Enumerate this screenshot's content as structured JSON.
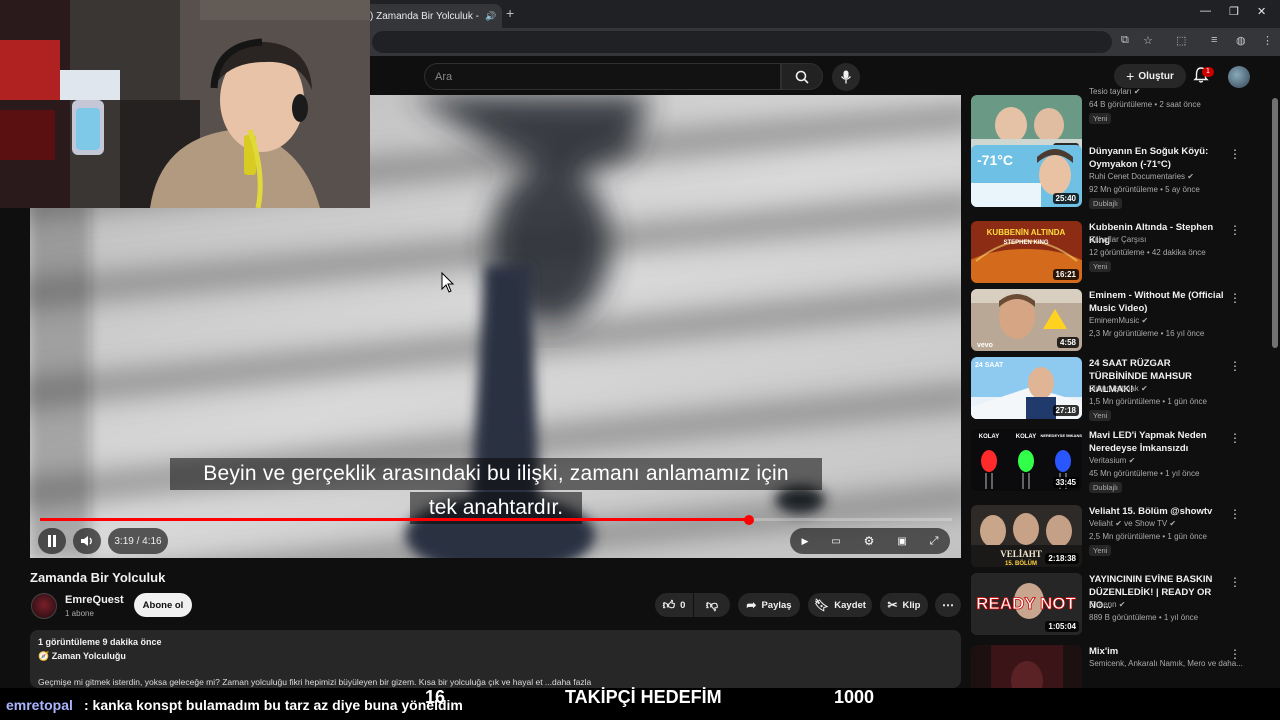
{
  "browser": {
    "tab_title": ") Zamanda Bir Yolculuk - ",
    "tab_close": "✕",
    "new_tab": "+"
  },
  "header": {
    "search_placeholder": "Ara",
    "create_label": "Oluştur",
    "notification_count": "1"
  },
  "video": {
    "subtitle_line1": "Beyin ve gerçeklik arasındaki bu ilişki, zamanı anlamamız için",
    "subtitle_line2": "tek anahtardır.",
    "time": "3:19 / 4:16",
    "progress": 0.777
  },
  "details": {
    "title": "Zamanda Bir Yolculuk",
    "channel": "EmreQuest",
    "subscribers": "1 abone",
    "subscribe_label": "Abone ol",
    "like_count": "0",
    "share_label": "Paylaş",
    "save_label": "Kaydet",
    "clip_label": "Klip",
    "views_time": "1 görüntüleme  9 dakika önce",
    "tag": "🧭 Zaman Yolculuğu",
    "description": "Geçmişe mi gitmek isterdin, yoksa geleceğe mi? Zaman yolculuğu fikri hepimizi büyüleyen bir gizem. Kısa bir yolculuğa çık ve hayal et ...daha fazla"
  },
  "sidebar": {
    "items": [
      {
        "title": "",
        "channel": "Tesio tayları ✔",
        "meta": "64 B görüntüleme • 2 saat önce",
        "badge": "Yeni",
        "duration": "28:04"
      },
      {
        "title": "Dünyanın En Soğuk Köyü: Oymyakon (-71°C)",
        "channel": "Ruhi Cenet Documentaries ✔",
        "meta": "92 Mn görüntüleme • 5 ay önce",
        "badge": "Dublajlı",
        "duration": "25:40"
      },
      {
        "title": "Kubbenin Altında - Stephen King",
        "channel": "Sahaflar Çarşısı",
        "meta": "12 görüntüleme • 42 dakika önce",
        "badge": "Yeni",
        "duration": "16:21"
      },
      {
        "title": "Eminem - Without Me (Official Music Video)",
        "channel": "EminemMusic ✔",
        "meta": "2,3 Mr görüntüleme • 16 yıl önce",
        "badge": "",
        "duration": "4:58"
      },
      {
        "title": "24 SAAT RÜZGAR TÜRBİNİNDE MAHSUR KALMAK!",
        "channel": "Orkun Işıtmak ✔",
        "meta": "1,5 Mn görüntüleme • 1 gün önce",
        "badge": "Yeni",
        "duration": "27:18"
      },
      {
        "title": "Mavi LED'i Yapmak Neden Neredeyse İmkansızdı",
        "channel": "Veritasium ✔",
        "meta": "45 Mn görüntüleme • 1 yıl önce",
        "badge": "Dublajlı",
        "duration": "33:45"
      },
      {
        "title": "Veliaht 15. Bölüm @showtv",
        "channel": "Veliaht ✔ ve Show TV ✔",
        "meta": "2,5 Mn görüntüleme • 1 gün önce",
        "badge": "Yeni",
        "duration": "2:18:38"
      },
      {
        "title": "YAYINCININ EVİNE BASKIN DÜZENLEDİK! | READY OR NO...",
        "channel": "Elraenn ✔",
        "meta": "889 B görüntüleme • 1 yıl önce",
        "badge": "",
        "duration": "1:05:04"
      },
      {
        "title": "Mix'im",
        "channel": "Semicenk, Ankaralı Namık, Mero ve daha...",
        "meta": "",
        "badge": "",
        "duration": ""
      }
    ],
    "thumb_texts": {
      "t1": "-71°C",
      "t2": "KUBBENİN ALTINDA",
      "t2b": "STEPHEN KING",
      "t3": "vevo",
      "t4": "24 SAAT",
      "t5a": "KOLAY",
      "t5b": "KOLAY",
      "t5c": "NEREDEYSE İMKANSIZ",
      "t6": "VELİAHT",
      "t6b": "15. BÖLÜM",
      "t7": "READY NOT"
    }
  },
  "overlay": {
    "chat_user": "emretopal",
    "chat_message": ": kanka konspt bulamadım bu tarz az diye buna yöneldim",
    "goal_count": "16",
    "goal_label": "TAKİPÇİ HEDEFİM",
    "goal_target": "1000"
  },
  "colors": {
    "accent": "#ff0000",
    "background": "#0f0f0f"
  }
}
